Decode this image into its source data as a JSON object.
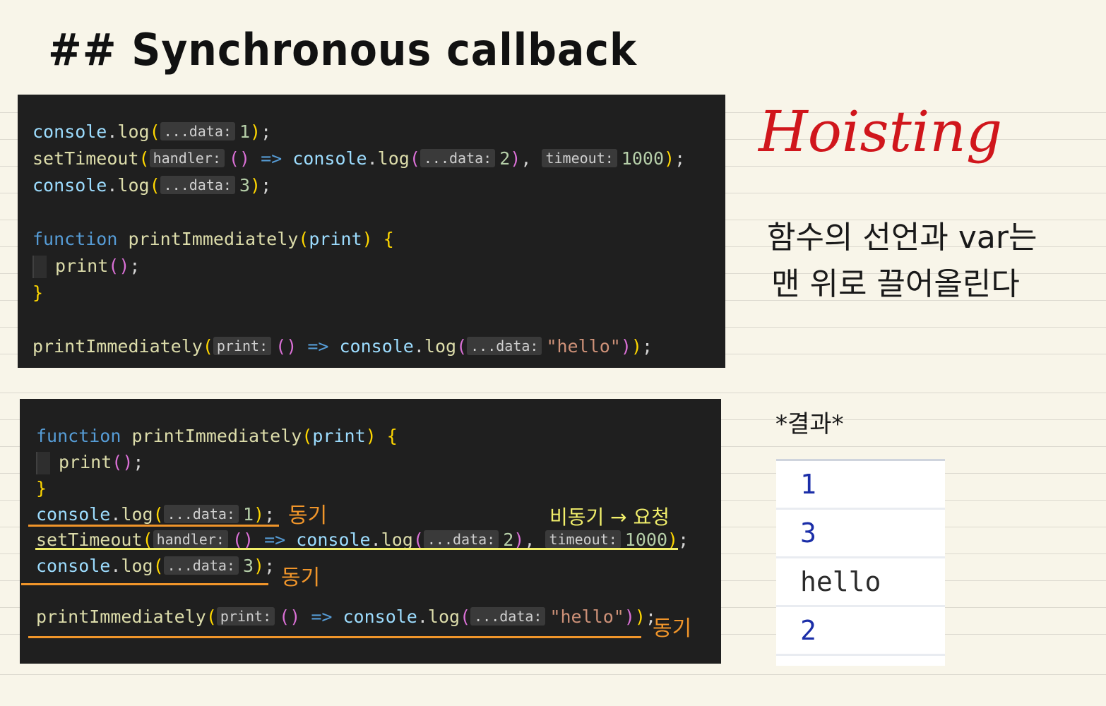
{
  "heading": "## Synchronous callback",
  "top_code": {
    "line1": {
      "obj": "console",
      "dot": ".",
      "fn": "log",
      "open": "(",
      "hint": "...data:",
      "arg": "1",
      "close": ")",
      "semi": ";"
    },
    "line2": {
      "fn": "setTimeout",
      "open": "(",
      "hint1": "handler:",
      "paren": "()",
      "arrow": "=>",
      "obj": "console",
      "dot": ".",
      "fn2": "log",
      "open2": "(",
      "hint2": "...data:",
      "arg": "2",
      "close2": ")",
      "comma": ",",
      "hint3": "timeout:",
      "arg2": "1000",
      "close": ")",
      "semi": ";"
    },
    "line3": {
      "obj": "console",
      "dot": ".",
      "fn": "log",
      "open": "(",
      "hint": "...data:",
      "arg": "3",
      "close": ")",
      "semi": ";"
    },
    "line4": {
      "kw": "function",
      "fn": "printImmediately",
      "open": "(",
      "param": "print",
      "close": ")",
      "brace": "{"
    },
    "line5": {
      "fn": "print",
      "parens": "()",
      "semi": ";"
    },
    "line6": {
      "brace": "}"
    },
    "line7": {
      "fn": "printImmediately",
      "open": "(",
      "hint1": "print:",
      "paren": "()",
      "arrow": "=>",
      "obj": "console",
      "dot": ".",
      "fn2": "log",
      "open2": "(",
      "hint2": "...data:",
      "str": "\"hello\"",
      "close2": ")",
      "close": ")",
      "semi": ";"
    }
  },
  "bottom_code": {
    "line1": {
      "kw": "function",
      "fn": "printImmediately",
      "open": "(",
      "param": "print",
      "close": ")",
      "brace": "{"
    },
    "line2": {
      "fn": "print",
      "parens": "()",
      "semi": ";"
    },
    "line3": {
      "brace": "}"
    },
    "line4": {
      "obj": "console",
      "dot": ".",
      "fn": "log",
      "open": "(",
      "hint": "...data:",
      "arg": "1",
      "close": ")",
      "semi": ";"
    },
    "line5": {
      "fn": "setTimeout",
      "open": "(",
      "hint1": "handler:",
      "paren": "()",
      "arrow": "=>",
      "obj": "console",
      "dot": ".",
      "fn2": "log",
      "open2": "(",
      "hint2": "...data:",
      "arg": "2",
      "close2": ")",
      "comma": ",",
      "hint3": "timeout:",
      "arg2": "1000",
      "close": ")",
      "semi": ";"
    },
    "line6": {
      "obj": "console",
      "dot": ".",
      "fn": "log",
      "open": "(",
      "hint": "...data:",
      "arg": "3",
      "close": ")",
      "semi": ";"
    },
    "line7": {
      "fn": "printImmediately",
      "open": "(",
      "hint1": "print:",
      "paren": "()",
      "arrow": "=>",
      "obj": "console",
      "dot": ".",
      "fn2": "log",
      "open2": "(",
      "hint2": "...data:",
      "str": "\"hello\"",
      "close2": ")",
      "close": ")",
      "semi": ";"
    }
  },
  "annotations": {
    "sync_1": "동기",
    "sync_3": "동기",
    "sync_hello": "동기",
    "async_request": "비동기 → 요청",
    "hoisting_title": "Hoisting",
    "hoisting_line1": "함수의 선언과 var는",
    "hoisting_line2": "맨 위로 끌어올린다",
    "result_label": "*결과*"
  },
  "results": [
    "1",
    "3",
    "hello",
    "2"
  ],
  "colors": {
    "page_bg": "#f8f5e9",
    "code_bg": "#1f1f1f",
    "hoisting_red": "#d0161c",
    "underline_orange": "#f0952a",
    "underline_yellow": "#f2ef6b"
  }
}
